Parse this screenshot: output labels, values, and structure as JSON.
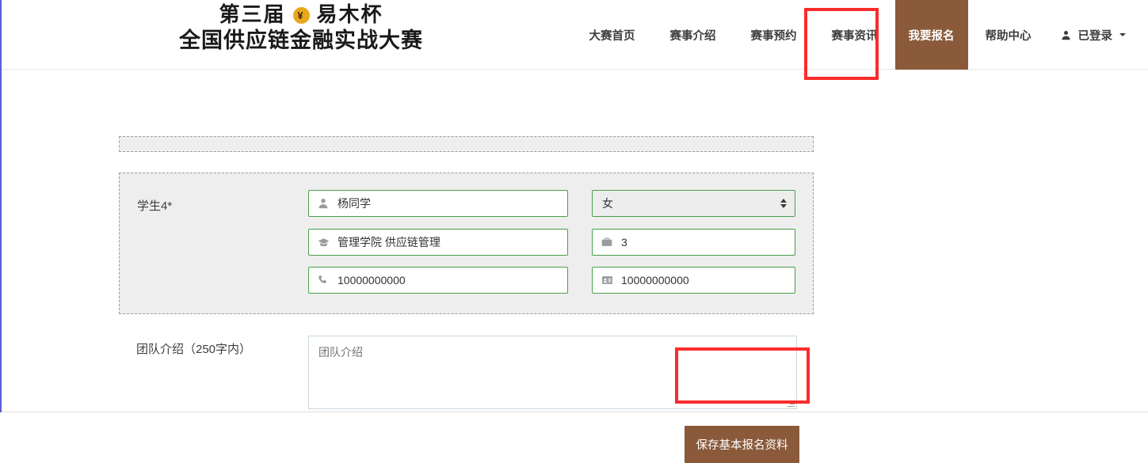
{
  "header": {
    "brand": {
      "line1_before": "第三届",
      "coin_symbol": "¥",
      "line1_after": "易木杯",
      "line2": "全国供应链金融实战大赛"
    },
    "nav_items": [
      {
        "label": "大赛首页",
        "active": false
      },
      {
        "label": "赛事介绍",
        "active": false
      },
      {
        "label": "赛事预约",
        "active": false
      },
      {
        "label": "赛事资讯",
        "active": false
      },
      {
        "label": "我要报名",
        "active": true
      },
      {
        "label": "帮助中心",
        "active": false
      }
    ],
    "user": {
      "label": "已登录",
      "icon": "user-icon"
    }
  },
  "form": {
    "student_block": {
      "label": "学生4*",
      "fields": {
        "name": {
          "icon": "user-icon",
          "value": "杨同学"
        },
        "gender": {
          "value": "女",
          "icon": "spinner-icon"
        },
        "major": {
          "icon": "graduation-cap-icon",
          "value": "管理学院 供应链管理"
        },
        "grade": {
          "icon": "briefcase-icon",
          "value": "3"
        },
        "phone": {
          "icon": "phone-icon",
          "value": "10000000000"
        },
        "idcard": {
          "icon": "id-card-icon",
          "value": "10000000000"
        }
      }
    },
    "team_intro": {
      "label": "团队介绍（250字内）",
      "placeholder": "团队介绍",
      "value": ""
    },
    "save_button": "保存基本报名资料"
  },
  "colors": {
    "brand_brown": "#8a5a3b",
    "field_green": "#4a9e4a",
    "annotation_red": "#fb2c2c",
    "coin_gold": "#e9a81b"
  }
}
